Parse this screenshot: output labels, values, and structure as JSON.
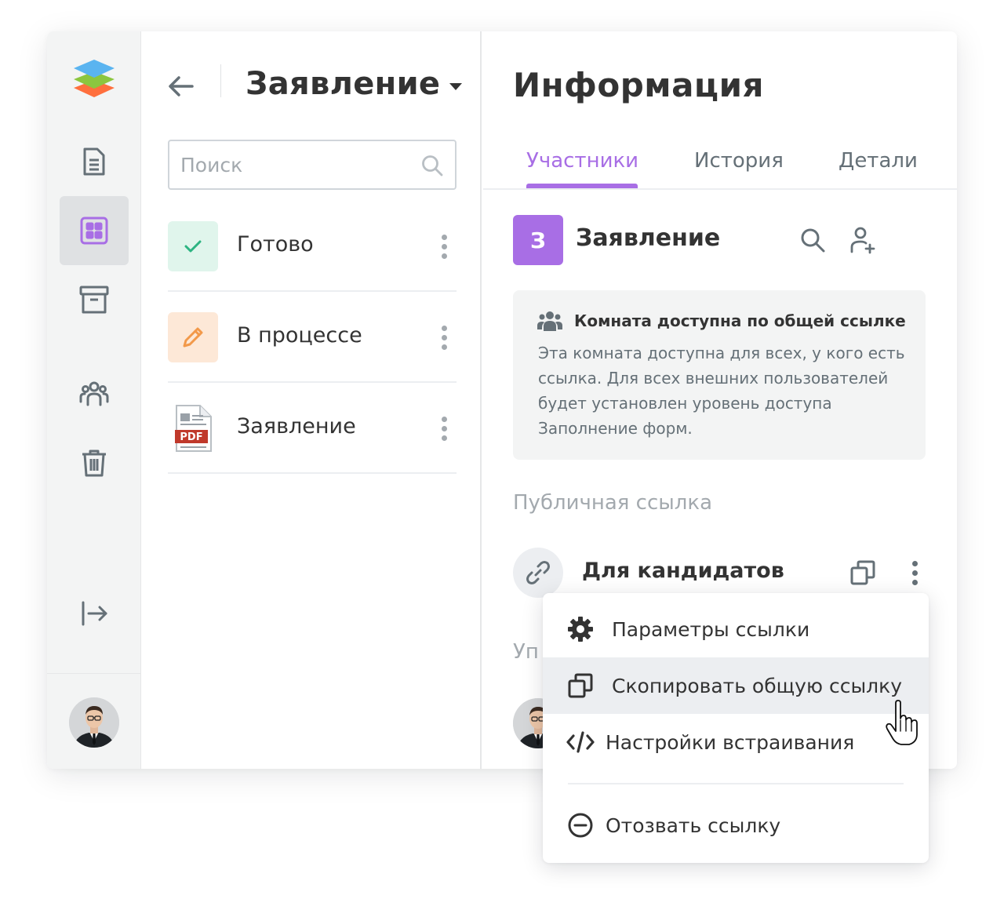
{
  "colors": {
    "accent": "#a86ee5",
    "done_bg": "#e0f5ec",
    "done_check": "#2db482",
    "progress_bg": "#fde8d7",
    "progress_pencil": "#f2994a",
    "pdf_red": "#c0392b",
    "logo_blue": "#5ab4f0",
    "logo_green": "#8cc63f",
    "logo_orange": "#ff6f3d"
  },
  "sidebar": {
    "items": [
      {
        "icon": "document-icon"
      },
      {
        "icon": "rooms-grid-icon",
        "active": true
      },
      {
        "icon": "archive-icon"
      },
      {
        "icon": "contacts-icon"
      },
      {
        "icon": "trash-icon"
      },
      {
        "icon": "logout-icon"
      }
    ]
  },
  "middle": {
    "title": "Заявление",
    "search_placeholder": "Поиск",
    "items": [
      {
        "label": "Готово",
        "icon": "check-icon"
      },
      {
        "label": "В процессе",
        "icon": "pencil-icon"
      },
      {
        "label": "Заявление",
        "icon": "pdf-file-icon",
        "badge": "PDF"
      }
    ]
  },
  "info": {
    "title": "Информация",
    "tabs": [
      {
        "label": "Участники",
        "active": true
      },
      {
        "label": "История"
      },
      {
        "label": "Детали"
      }
    ],
    "room": {
      "initial": "З",
      "name": "Заявление"
    },
    "notice": {
      "title": "Комната доступна по общей ссылке",
      "text": "Эта комната доступна для всех, у кого есть ссылка. Для всех внешних пользователей будет установлен уровень доступа Заполнение форм."
    },
    "public_link_label": "Публичная ссылка",
    "link_name": "Для кандидатов",
    "members_label_partial": "Уп"
  },
  "menu": {
    "items": [
      {
        "label": "Параметры ссылки",
        "icon": "gear-icon"
      },
      {
        "label": "Скопировать общую ссылку",
        "icon": "copy-icon",
        "hover": true
      },
      {
        "label": "Настройки встраивания",
        "icon": "embed-code-icon"
      },
      {
        "label": "Отозвать ссылку",
        "icon": "revoke-icon"
      }
    ]
  }
}
